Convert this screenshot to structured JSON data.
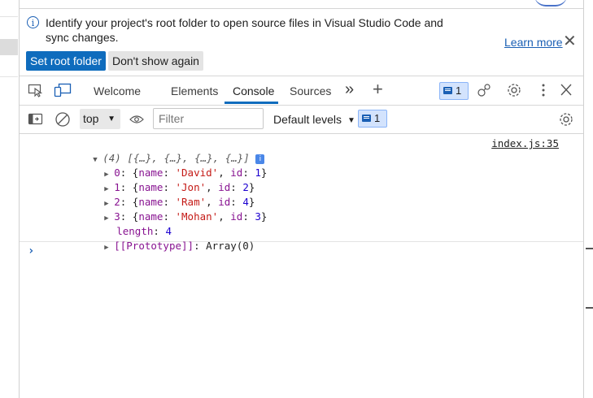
{
  "infobar": {
    "message": "Identify your project's root folder to open source files in Visual Studio Code and sync changes.",
    "learn_more": "Learn more",
    "close_glyph": "✕",
    "set_root_button": "Set root folder",
    "dont_show_button": "Don't show again"
  },
  "tabs": {
    "items": [
      "Welcome",
      "Elements",
      "Console",
      "Sources"
    ],
    "active": "Console",
    "more_glyph": "»",
    "add_glyph": "+",
    "issues_count": "1",
    "icons": [
      "inspect-element-icon",
      "device-emulation-icon",
      "more-tabs-icon",
      "new-tab-icon",
      "issues-icon",
      "performance-icon",
      "settings-icon",
      "more-options-icon",
      "close-devtools-icon"
    ]
  },
  "console_toolbar": {
    "context": "top",
    "filter_placeholder": "Filter",
    "levels": "Default levels",
    "messages_count": "1"
  },
  "console": {
    "summary": "(4) [{…}, {…}, {…}, {…}]",
    "source_link": "index.js:35",
    "entries": [
      {
        "index": "0",
        "name": "'David'",
        "id": "1"
      },
      {
        "index": "1",
        "name": "'Jon'",
        "id": "2"
      },
      {
        "index": "2",
        "name": "'Ram'",
        "id": "4"
      },
      {
        "index": "3",
        "name": "'Mohan'",
        "id": "3"
      }
    ],
    "length_label": "length",
    "length_value": "4",
    "prototype_label": "[[Prototype]]",
    "prototype_value": "Array(0)",
    "prompt_glyph": "›"
  },
  "colors": {
    "accent": "#0f6cbd",
    "key": "#881391",
    "string": "#c41a16",
    "number": "#1c00cf"
  }
}
